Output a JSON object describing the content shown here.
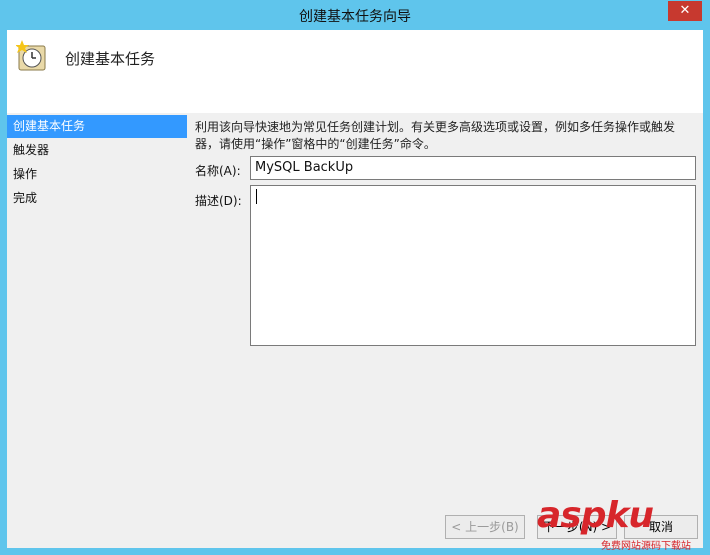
{
  "window": {
    "title": "创建基本任务向导",
    "close_label": "✕"
  },
  "header": {
    "title": "创建基本任务",
    "icon": "clock-task-icon"
  },
  "sidebar": {
    "items": [
      {
        "label": "创建基本任务",
        "selected": true
      },
      {
        "label": "触发器",
        "selected": false
      },
      {
        "label": "操作",
        "selected": false
      },
      {
        "label": "完成",
        "selected": false
      }
    ]
  },
  "main": {
    "description": "利用该向导快速地为常见任务创建计划。有关更多高级选项或设置，例如多任务操作或触发器，请使用“操作”窗格中的“创建任务”命令。",
    "name_label": "名称(A):",
    "name_value": "MySQL BackUp",
    "desc_label": "描述(D):",
    "desc_value": ""
  },
  "buttons": {
    "back": "< 上一步(B)",
    "next": "下一步(N) >",
    "cancel": "取消"
  },
  "watermark": {
    "main": "aspku",
    "sub": "免费网站源码下载站"
  },
  "colors": {
    "title_bar": "#5fc5ec",
    "selected": "#3399ff",
    "close": "#c7392f",
    "watermark": "#d7262b"
  }
}
